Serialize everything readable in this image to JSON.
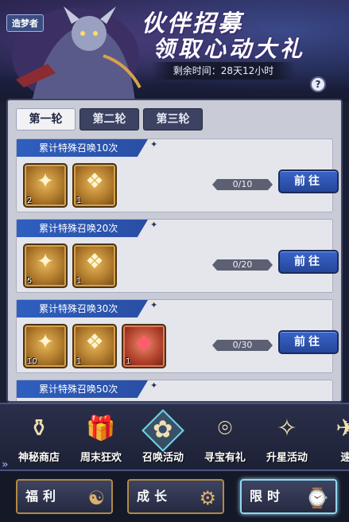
{
  "banner": {
    "creator_badge": "造梦者",
    "title_line1": "伙伴招募",
    "title_line2": "领取心动大礼",
    "timer_text": "剩余时间：28天12小时",
    "help_label": "?"
  },
  "tabs": [
    {
      "label": "第一轮",
      "active": true
    },
    {
      "label": "第二轮",
      "active": false
    },
    {
      "label": "第三轮",
      "active": false
    }
  ],
  "tasks": [
    {
      "title": "累计特殊召唤10次",
      "rewards": [
        {
          "icon": "gold-chest-icon",
          "glyph": "✦",
          "count": "2"
        },
        {
          "icon": "gift-sack-icon",
          "glyph": "❖",
          "count": "1"
        }
      ],
      "progress": "0/10",
      "button": "前往"
    },
    {
      "title": "累计特殊召唤20次",
      "rewards": [
        {
          "icon": "gold-chest-icon",
          "glyph": "✦",
          "count": "5"
        },
        {
          "icon": "gift-sack-icon",
          "glyph": "❖",
          "count": "1"
        }
      ],
      "progress": "0/20",
      "button": "前往"
    },
    {
      "title": "累计特殊召唤30次",
      "rewards": [
        {
          "icon": "gold-chest-icon",
          "glyph": "✦",
          "count": "10"
        },
        {
          "icon": "gift-sack-icon",
          "glyph": "❖",
          "count": "1"
        },
        {
          "icon": "red-gem-icon",
          "glyph": "◆",
          "count": "1"
        }
      ],
      "progress": "0/30",
      "button": "前往"
    },
    {
      "title": "累计特殊召唤50次"
    }
  ],
  "activities": [
    {
      "label": "神秘商店",
      "icon": "mystery-shop-icon",
      "glyph": "⚱",
      "selected": false
    },
    {
      "label": "周末狂欢",
      "icon": "weekend-gift-icon",
      "glyph": "🎁",
      "selected": false
    },
    {
      "label": "召唤活动",
      "icon": "summon-bow-icon",
      "glyph": "✿",
      "selected": true
    },
    {
      "label": "寻宝有礼",
      "icon": "treasure-compass-icon",
      "glyph": "⌾",
      "selected": false
    },
    {
      "label": "升星活动",
      "icon": "star-up-icon",
      "glyph": "✧",
      "selected": false
    },
    {
      "label": "速",
      "icon": "speed-icon",
      "glyph": "✈",
      "selected": false
    }
  ],
  "bottom_nav": [
    {
      "label": "福利",
      "active": false
    },
    {
      "label": "成长",
      "active": false
    },
    {
      "label": "限时",
      "active": true
    }
  ],
  "colors": {
    "accent_blue": "#2f5fbf",
    "panel_bg": "#c9ccd6",
    "gold_border": "#b18a45",
    "active_glow": "#8fd8f0"
  }
}
